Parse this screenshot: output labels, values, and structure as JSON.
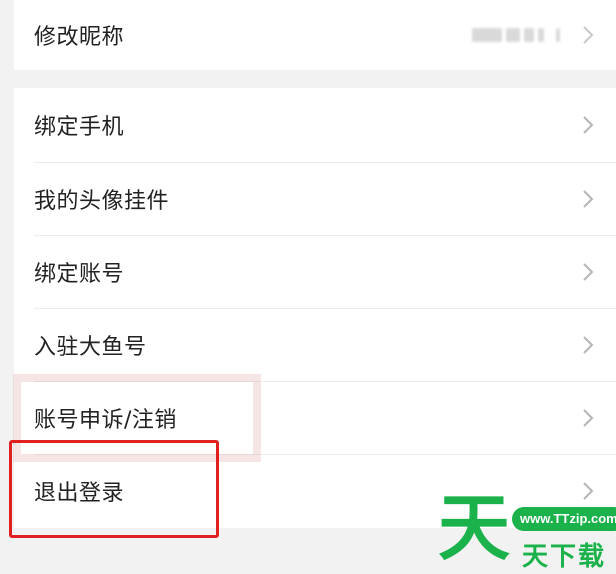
{
  "settings": {
    "nickname_row": {
      "label": "修改昵称"
    },
    "rows": [
      {
        "label": "绑定手机"
      },
      {
        "label": "我的头像挂件"
      },
      {
        "label": "绑定账号"
      },
      {
        "label": "入驻大鱼号"
      },
      {
        "label": "账号申诉/注销"
      },
      {
        "label": "退出登录"
      }
    ]
  },
  "watermark": {
    "big_char": "天",
    "site": "www.TTzip.com",
    "text": "天下载"
  },
  "colors": {
    "background": "#f2f2f2",
    "card": "#ffffff",
    "highlight_red": "#e02020",
    "watermark_green": "#1bb24b"
  }
}
